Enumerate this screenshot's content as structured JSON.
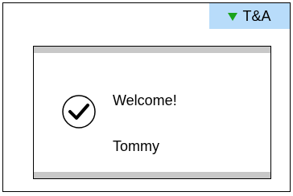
{
  "status": {
    "label": "T&A",
    "indicator_icon": "triangle-down-icon",
    "background_color": "#b8dcfa",
    "indicator_color": "#1aa31a"
  },
  "dialog": {
    "icon": "checkmark-circle-icon",
    "message": "Welcome!",
    "user_name": "Tommy",
    "bar_color": "#c8c8c8"
  }
}
